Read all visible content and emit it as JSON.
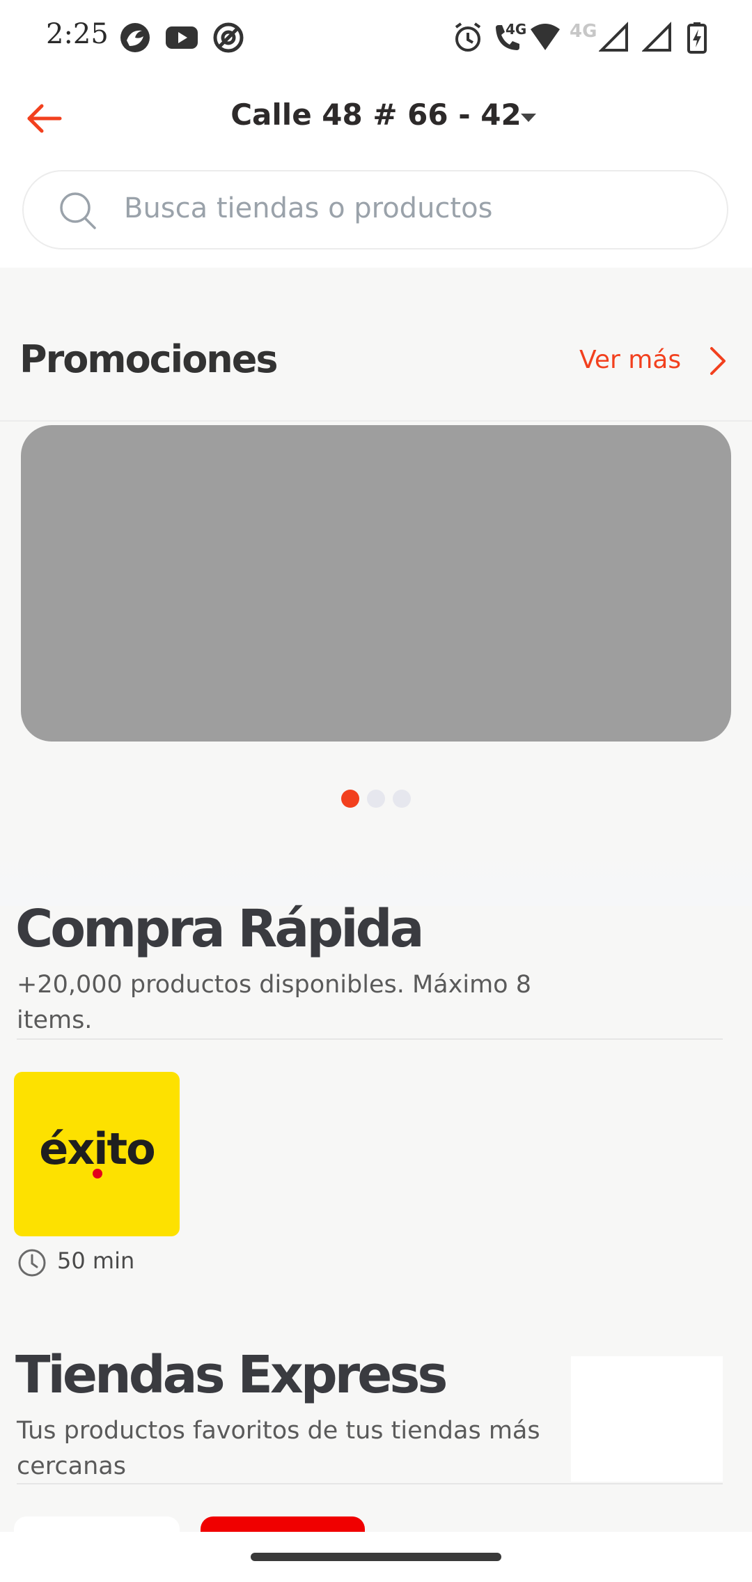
{
  "status_bar": {
    "time": "2:25",
    "network_label": "4G",
    "icons": [
      "browser-icon",
      "youtube-icon",
      "vpn-icon",
      "alarm-icon",
      "volte-call-icon",
      "wifi-icon",
      "signal-icon",
      "signal-icon",
      "battery-charging-icon"
    ]
  },
  "header": {
    "address": "Calle 48 # 66 - 42",
    "back_icon": "arrow-left-icon",
    "dropdown_icon": "caret-down-icon"
  },
  "search": {
    "placeholder": "Busca tiendas o productos",
    "value": ""
  },
  "promotions": {
    "title": "Promociones",
    "see_more": "Ver más",
    "carousel_active_index": 0,
    "carousel_count": 3
  },
  "quick_buy": {
    "title": "Compra Rápida",
    "subtitle": "+20,000 productos disponibles. Máximo 8 items.",
    "stores": [
      {
        "logo_text": "éxito",
        "delivery_time": "50 min"
      }
    ]
  },
  "express": {
    "title": "Tiendas Express",
    "subtitle": "Tus productos favoritos de tus tiendas más cercanas"
  },
  "colors": {
    "accent": "#f2401e",
    "background": "#f7f7f6",
    "exito_yellow": "#fde100",
    "banner_placeholder": "#9e9e9e",
    "red_card": "#f00000"
  }
}
